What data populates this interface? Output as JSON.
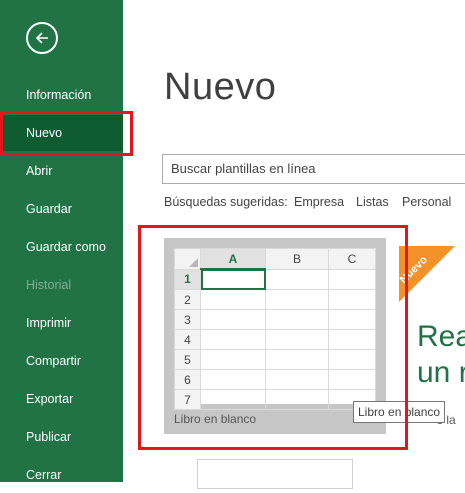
{
  "sidebar": {
    "back_icon": "back-arrow-icon",
    "items": [
      {
        "label": "Información",
        "state": "normal"
      },
      {
        "label": "Nuevo",
        "state": "selected"
      },
      {
        "label": "Abrir",
        "state": "normal"
      },
      {
        "label": "Guardar",
        "state": "normal"
      },
      {
        "label": "Guardar como",
        "state": "normal"
      },
      {
        "label": "Historial",
        "state": "disabled"
      },
      {
        "label": "Imprimir",
        "state": "normal"
      },
      {
        "label": "Compartir",
        "state": "normal"
      },
      {
        "label": "Exportar",
        "state": "normal"
      },
      {
        "label": "Publicar",
        "state": "normal"
      },
      {
        "label": "Cerrar",
        "state": "normal"
      }
    ]
  },
  "main": {
    "title": "Nuevo",
    "search_placeholder": "Buscar plantillas en línea",
    "suggested": {
      "label": "Búsquedas sugeridas:",
      "links": [
        "Empresa",
        "Listas",
        "Personal"
      ]
    },
    "blank_template": {
      "columns": [
        "A",
        "B",
        "C"
      ],
      "rows": [
        "1",
        "2",
        "3",
        "4",
        "5",
        "6",
        "7"
      ],
      "label": "Libro en blanco",
      "tooltip": "Libro en blanco"
    },
    "tour_template": {
      "ribbon": "Nuevo",
      "line1": "Rea",
      "line2": "un r",
      "caption": "s la"
    }
  },
  "colors": {
    "sidebar_bg": "#217346",
    "selected_bg": "#0f5c32",
    "highlight_red": "#e0181e",
    "accent_orange": "#f4922a"
  }
}
